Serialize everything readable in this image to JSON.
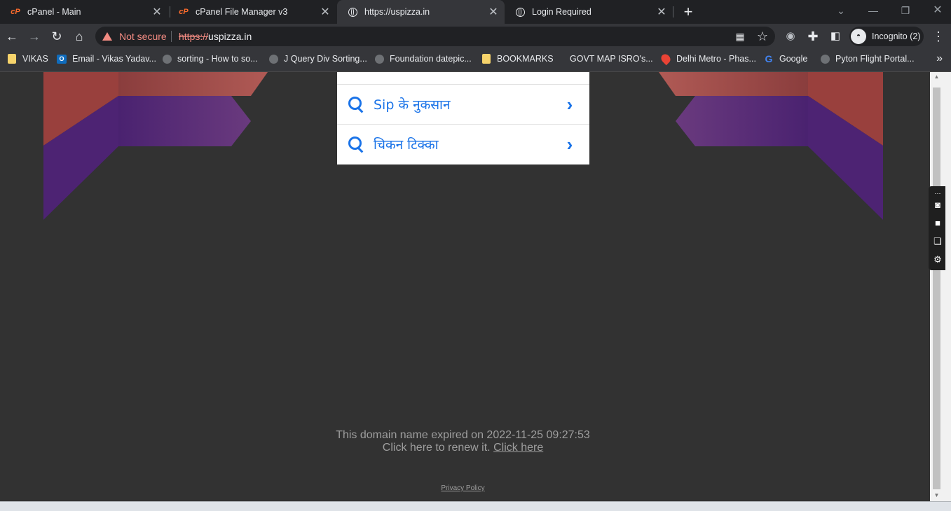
{
  "tabs": [
    {
      "title": "cPanel - Main",
      "icon": "cpanel-icon",
      "active": false
    },
    {
      "title": "cPanel File Manager v3",
      "icon": "cpanel-icon",
      "active": false
    },
    {
      "title": "https://uspizza.in",
      "icon": "globe-icon",
      "active": true
    },
    {
      "title": "Login Required",
      "icon": "globe-icon",
      "active": false
    }
  ],
  "favicon_text": "cP",
  "new_tab_label": "+",
  "toolbar": {
    "security_label": "Not secure",
    "url_scheme": "https://",
    "url_host": "uspizza.in",
    "profile_label": "Incognito (2)"
  },
  "bookmarks": [
    {
      "label": "VIKAS",
      "icon": "folder-icon"
    },
    {
      "label": "Email - Vikas Yadav...",
      "icon": "outlook-icon"
    },
    {
      "label": "sorting - How to so...",
      "icon": "globe-icon"
    },
    {
      "label": "J Query Div Sorting...",
      "icon": "globe-icon"
    },
    {
      "label": "Foundation datepic...",
      "icon": "globe-icon"
    },
    {
      "label": "BOOKMARKS",
      "icon": "folder-icon"
    },
    {
      "label": "GOVT MAP ISRO's...",
      "icon": "none"
    },
    {
      "label": "Delhi Metro - Phas...",
      "icon": "map-pin-icon"
    },
    {
      "label": "Google",
      "icon": "google-icon"
    },
    {
      "label": "Pyton Flight Portal...",
      "icon": "globe-icon"
    }
  ],
  "suggestions": [
    {
      "text": "Sip के नुकसान"
    },
    {
      "text": "चिकन टिक्का"
    }
  ],
  "expired": {
    "line1": "This domain name expired on 2022-11-25 09:27:53",
    "line2": "Click here to renew it.",
    "link": "Click here"
  },
  "privacy_policy": "Privacy Policy",
  "colors": {
    "background": "#323232",
    "suggestion_accent": "#1a73e8",
    "decor_red": "#a34a4a",
    "decor_purple": "#5a2a7a",
    "not_secure": "#f28b82"
  }
}
